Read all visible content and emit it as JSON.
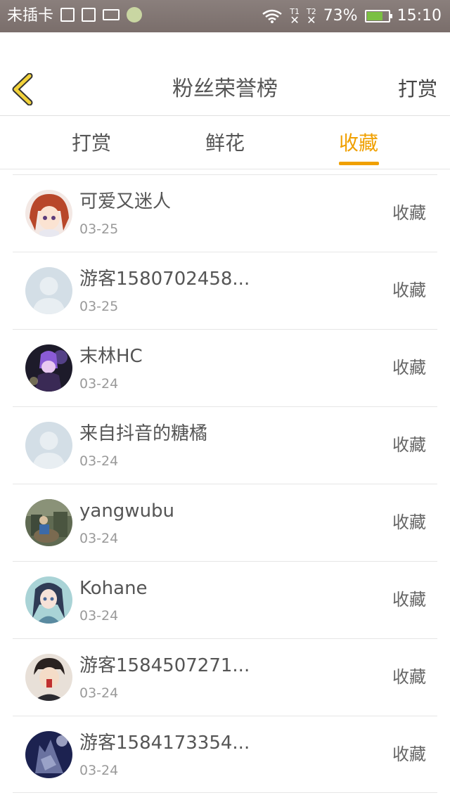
{
  "status_bar": {
    "carrier": "未插卡",
    "sim1": "1",
    "sim2": "2",
    "battery_percent": "73%",
    "battery_level": 0.73,
    "time": "15:10",
    "icons": [
      "sim-alert-icon",
      "image-icon",
      "keyboard-icon",
      "app-icon",
      "wifi-icon",
      "battery-icon"
    ]
  },
  "header": {
    "title": "粉丝荣誉榜",
    "action": "打赏",
    "back_icon": "chevron-left-icon",
    "accent_color": "#f0a000"
  },
  "tabs": [
    {
      "label": "打赏",
      "active": false
    },
    {
      "label": "鲜花",
      "active": false
    },
    {
      "label": "收藏",
      "active": true
    }
  ],
  "fans": [
    {
      "name": "可爱又迷人",
      "date": "03-25",
      "action": "收藏",
      "avatar": "anime-girl-avatar"
    },
    {
      "name": "游客1580702458...",
      "date": "03-25",
      "action": "收藏",
      "avatar": "default-avatar"
    },
    {
      "name": "末林HC",
      "date": "03-24",
      "action": "收藏",
      "avatar": "purple-character-avatar"
    },
    {
      "name": "来自抖音的糖橘",
      "date": "03-24",
      "action": "收藏",
      "avatar": "default-avatar"
    },
    {
      "name": "yangwubu",
      "date": "03-24",
      "action": "收藏",
      "avatar": "photo-avatar"
    },
    {
      "name": "Kohane",
      "date": "03-24",
      "action": "收藏",
      "avatar": "anime-girl-avatar"
    },
    {
      "name": "游客1584507271...",
      "date": "03-24",
      "action": "收藏",
      "avatar": "anime-boy-avatar"
    },
    {
      "name": "游客1584173354...",
      "date": "03-24",
      "action": "收藏",
      "avatar": "wolf-avatar"
    }
  ]
}
